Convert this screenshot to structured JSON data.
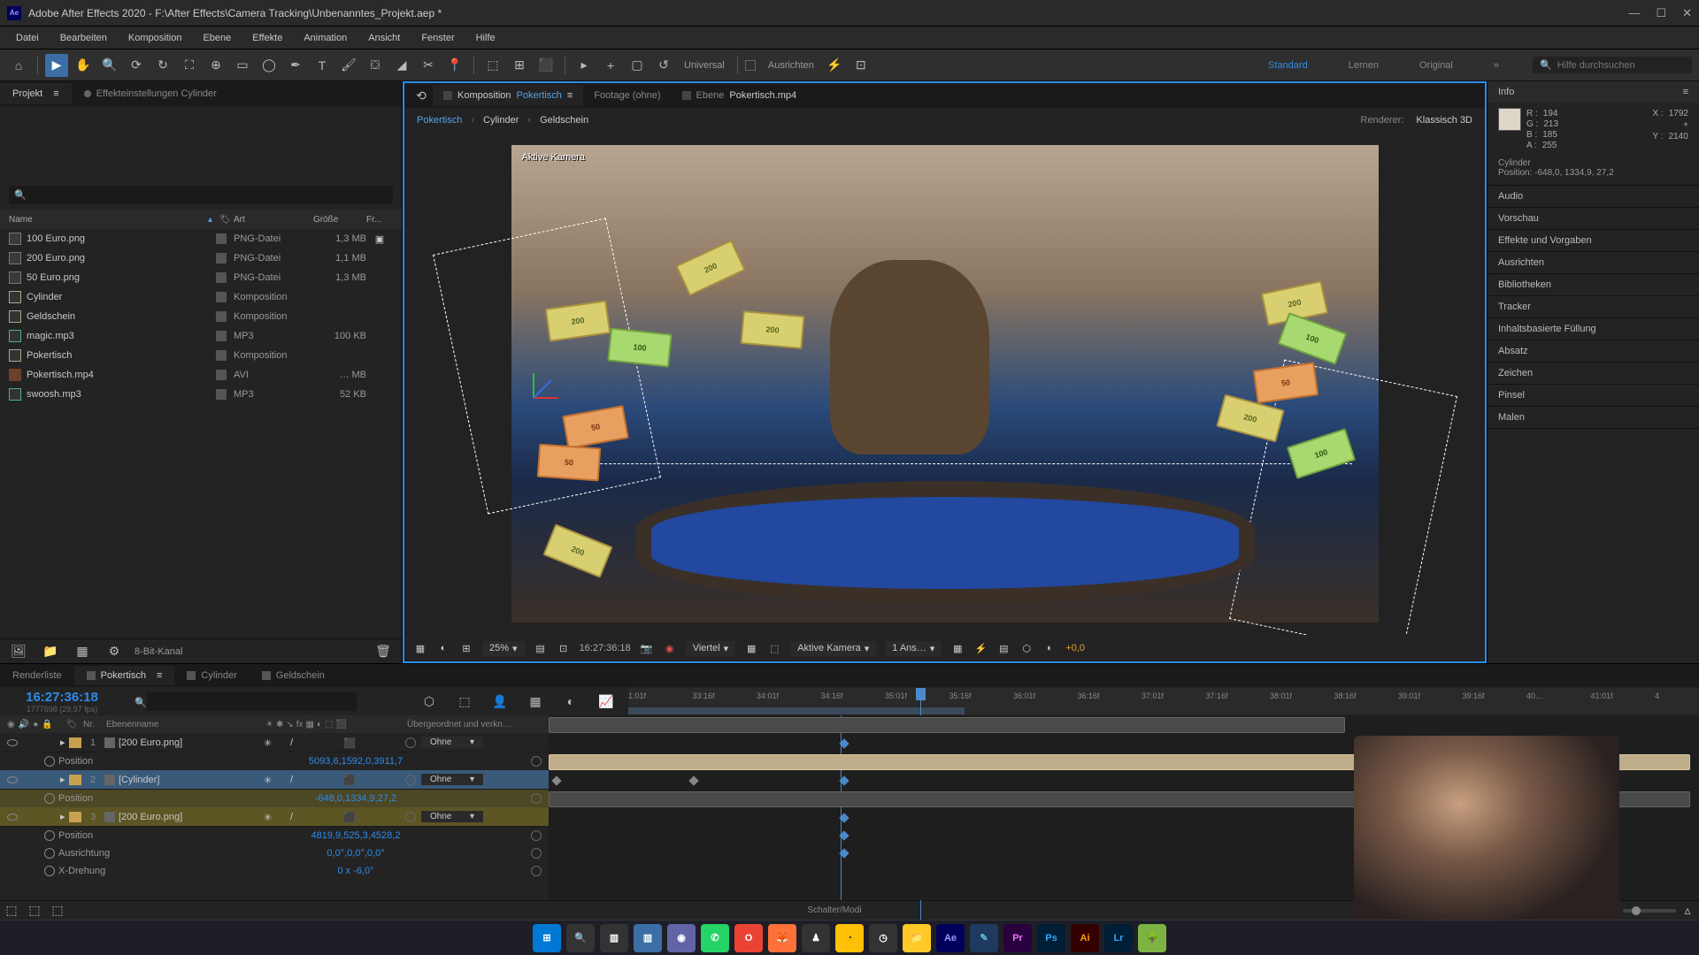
{
  "titlebar": {
    "app": "Ae",
    "title": "Adobe After Effects 2020 - F:\\After Effects\\Camera Tracking\\Unbenanntes_Projekt.aep *"
  },
  "menu": [
    "Datei",
    "Bearbeiten",
    "Komposition",
    "Ebene",
    "Effekte",
    "Animation",
    "Ansicht",
    "Fenster",
    "Hilfe"
  ],
  "toolbar": {
    "universal_label": "Universal",
    "ausrichten_label": "Ausrichten",
    "search_placeholder": "Hilfe durchsuchen"
  },
  "workspaces": {
    "standard": "Standard",
    "lernen": "Lernen",
    "original": "Original"
  },
  "project": {
    "tab1": "Projekt",
    "tab2": "Effekteinstellungen Cylinder",
    "headers": {
      "name": "Name",
      "type": "Art",
      "size": "Größe",
      "fr": "Fr..."
    },
    "items": [
      {
        "name": "100 Euro.png",
        "type": "PNG-Datei",
        "size": "1,3 MB",
        "icon": "png",
        "flag": true
      },
      {
        "name": "200 Euro.png",
        "type": "PNG-Datei",
        "size": "1,1 MB",
        "icon": "png",
        "flag": false
      },
      {
        "name": "50 Euro.png",
        "type": "PNG-Datei",
        "size": "1,3 MB",
        "icon": "png",
        "flag": false
      },
      {
        "name": "Cylinder",
        "type": "Komposition",
        "size": "",
        "icon": "comp",
        "flag": false
      },
      {
        "name": "Geldschein",
        "type": "Komposition",
        "size": "",
        "icon": "comp",
        "flag": false
      },
      {
        "name": "magic.mp3",
        "type": "MP3",
        "size": "100 KB",
        "icon": "mp3",
        "flag": false
      },
      {
        "name": "Pokertisch",
        "type": "Komposition",
        "size": "",
        "icon": "comp",
        "flag": false
      },
      {
        "name": "Pokertisch.mp4",
        "type": "AVI",
        "size": "… MB",
        "icon": "avi",
        "flag": false
      },
      {
        "name": "swoosh.mp3",
        "type": "MP3",
        "size": "52 KB",
        "icon": "mp3",
        "flag": false
      }
    ],
    "footer_depth": "8-Bit-Kanal"
  },
  "comp": {
    "tabs": {
      "komp_prefix": "Komposition",
      "komp_name": "Pokertisch",
      "footage": "Footage (ohne)",
      "ebene_prefix": "Ebene",
      "ebene_name": "Pokertisch.mp4"
    },
    "breadcrumb": [
      "Pokertisch",
      "Cylinder",
      "Geldschein"
    ],
    "renderer_label": "Renderer:",
    "renderer_value": "Klassisch 3D",
    "camera_label": "Aktive Kamera",
    "footer": {
      "zoom": "25%",
      "tc": "16:27:36:18",
      "resolution": "Viertel",
      "camera": "Aktive Kamera",
      "views": "1 Ans…",
      "exposure": "+0,0"
    }
  },
  "info": {
    "header": "Info",
    "r": "194",
    "g": "213",
    "b": "185",
    "a": "255",
    "x_lbl": "X :",
    "x": "1792",
    "y_lbl": "Y :",
    "y": "2140",
    "r_lbl": "R :",
    "g_lbl": "G :",
    "b_lbl": "B :",
    "a_lbl": "A :",
    "sel_name": "Cylinder",
    "sel_pos": "Position: -648,0, 1334,9, 27,2"
  },
  "right_panels": [
    "Audio",
    "Vorschau",
    "Effekte und Vorgaben",
    "Ausrichten",
    "Bibliotheken",
    "Tracker",
    "Inhaltsbasierte Füllung",
    "Absatz",
    "Zeichen",
    "Pinsel",
    "Malen"
  ],
  "timeline": {
    "tabs": [
      "Renderliste",
      "Pokertisch",
      "Cylinder",
      "Geldschein"
    ],
    "timecode": "16:27:36:18",
    "frames": "1777698 (29,97 fps)",
    "headers": {
      "nr": "Nr.",
      "name": "Ebenenname",
      "parent": "Übergeordnet und verkn…"
    },
    "ruler": [
      "1:01f",
      "33:16f",
      "34:01f",
      "34:16f",
      "35:01f",
      "35:16f",
      "36:01f",
      "36:16f",
      "37:01f",
      "37:16f",
      "38:01f",
      "38:16f",
      "39:01f",
      "39:16f",
      "40…",
      "41:01f",
      "4"
    ],
    "layers": [
      {
        "num": "1",
        "name": "[200 Euro.png]",
        "parent": "Ohne",
        "props": [
          {
            "n": "Position",
            "v": "5093,6,1592,0,3911,7"
          }
        ]
      },
      {
        "num": "2",
        "name": "[Cylinder]",
        "parent": "Ohne",
        "selected": true,
        "props": [
          {
            "n": "Position",
            "v": "-648,0,1334,9,27,2",
            "hl": true
          }
        ]
      },
      {
        "num": "3",
        "name": "[200 Euro.png]",
        "parent": "Ohne",
        "hl": true,
        "props": [
          {
            "n": "Position",
            "v": "4819,9,525,3,4528,2"
          },
          {
            "n": "Ausrichtung",
            "v": "0,0°,0,0°,0,0°"
          },
          {
            "n": "X-Drehung",
            "v": "0 x -6,0°"
          }
        ]
      }
    ],
    "switch_label": "Schalter/Modi"
  },
  "taskbar": [
    {
      "bg": "#0078d4",
      "fg": "#fff",
      "t": "⊞"
    },
    {
      "bg": "#333",
      "fg": "#fff",
      "t": "🔍"
    },
    {
      "bg": "#333",
      "fg": "#fff",
      "t": "▥"
    },
    {
      "bg": "#3a6ea5",
      "fg": "#fff",
      "t": "▥"
    },
    {
      "bg": "#6264a7",
      "fg": "#fff",
      "t": "◉"
    },
    {
      "bg": "#25d366",
      "fg": "#fff",
      "t": "✆"
    },
    {
      "bg": "#ea4335",
      "fg": "#fff",
      "t": "O"
    },
    {
      "bg": "#ff7139",
      "fg": "#fff",
      "t": "🦊"
    },
    {
      "bg": "#333",
      "fg": "#fff",
      "t": "♟"
    },
    {
      "bg": "#ffc107",
      "fg": "#333",
      "t": "◔"
    },
    {
      "bg": "#333",
      "fg": "#fff",
      "t": "◷"
    },
    {
      "bg": "#ffca28",
      "fg": "#333",
      "t": "📁"
    },
    {
      "bg": "#00005b",
      "fg": "#9999ff",
      "t": "Ae"
    },
    {
      "bg": "#1e3a5f",
      "fg": "#5bc0de",
      "t": "✎"
    },
    {
      "bg": "#2a003f",
      "fg": "#ea77ff",
      "t": "Pr"
    },
    {
      "bg": "#001e36",
      "fg": "#31a8ff",
      "t": "Ps"
    },
    {
      "bg": "#330000",
      "fg": "#ff9a00",
      "t": "Ai"
    },
    {
      "bg": "#001e36",
      "fg": "#31a8ff",
      "t": "Lr"
    },
    {
      "bg": "#7cb342",
      "fg": "#fff",
      "t": "🌳"
    }
  ]
}
